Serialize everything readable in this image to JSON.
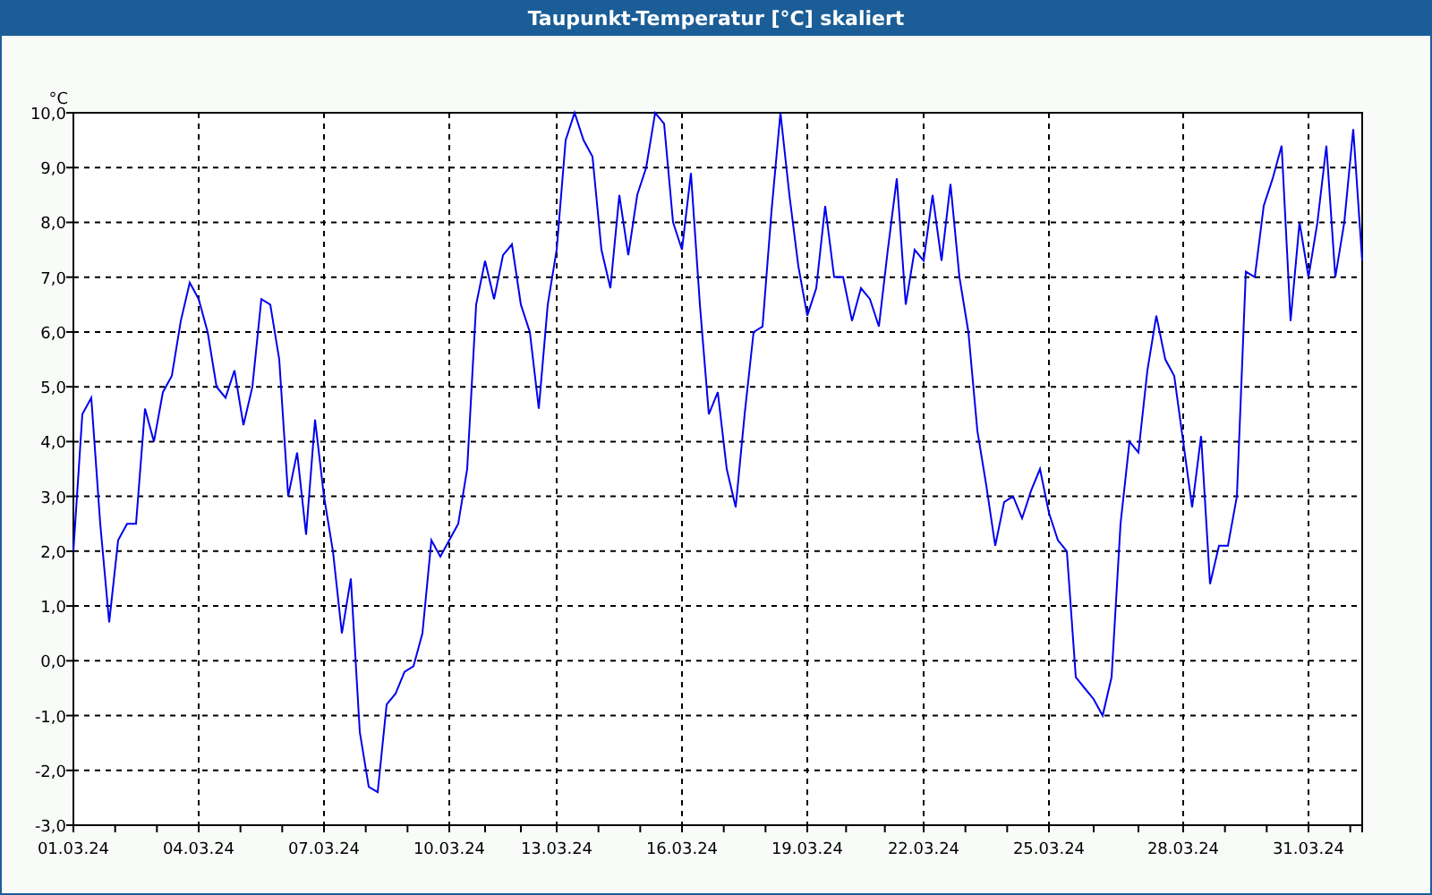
{
  "window": {
    "title": "Taupunkt-Temperatur [°C] skaliert"
  },
  "chart": {
    "chart_data": {
      "type": "line",
      "grid": true,
      "ylabel": "°C",
      "ylim": [
        -3,
        10
      ],
      "categories": [
        "01.03.24",
        null,
        null,
        null,
        null,
        null,
        null,
        null,
        null,
        null,
        null,
        null,
        null,
        null,
        "04.03.24",
        null,
        null,
        null,
        null,
        null,
        null,
        null,
        null,
        null,
        null,
        null,
        null,
        null,
        "07.03.24",
        null,
        null,
        null,
        null,
        null,
        null,
        null,
        null,
        null,
        null,
        null,
        null,
        null,
        "10.03.24",
        null,
        null,
        null,
        null,
        null,
        null,
        null,
        null,
        null,
        null,
        null,
        "13.03.24",
        null,
        null,
        null,
        null,
        null,
        null,
        null,
        null,
        null,
        null,
        null,
        null,
        null,
        "16.03.24",
        null,
        null,
        null,
        null,
        null,
        null,
        null,
        null,
        null,
        null,
        null,
        null,
        null,
        "19.03.24",
        null,
        null,
        null,
        null,
        null,
        null,
        null,
        null,
        null,
        null,
        null,
        null,
        "22.03.24",
        null,
        null,
        null,
        null,
        null,
        null,
        null,
        null,
        null,
        null,
        null,
        null,
        null,
        "25.03.24",
        null,
        null,
        null,
        null,
        null,
        null,
        null,
        null,
        null,
        null,
        null,
        null,
        null,
        null,
        "28.03.24",
        null,
        null,
        null,
        null,
        null,
        null,
        null,
        null,
        null,
        null,
        null,
        null,
        null,
        "31.03.24",
        null,
        null,
        null,
        null,
        null,
        null
      ],
      "yticks": [
        {
          "value": -3,
          "label": "-3,0"
        },
        {
          "value": -2,
          "label": "-2,0"
        },
        {
          "value": -1,
          "label": "-1,0"
        },
        {
          "value": 0,
          "label": "0,0"
        },
        {
          "value": 1,
          "label": "1,0"
        },
        {
          "value": 2,
          "label": "2,0"
        },
        {
          "value": 3,
          "label": "3,0"
        },
        {
          "value": 4,
          "label": "4,0"
        },
        {
          "value": 5,
          "label": "5,0"
        },
        {
          "value": 6,
          "label": "6,0"
        },
        {
          "value": 7,
          "label": "7,0"
        },
        {
          "value": 8,
          "label": "8,0"
        },
        {
          "value": 9,
          "label": "9,0"
        },
        {
          "value": 10,
          "label": "10,0"
        }
      ],
      "series": [
        {
          "color": "#0000ee",
          "values": [
            2.0,
            4.5,
            4.8,
            2.5,
            0.7,
            2.2,
            2.5,
            2.5,
            4.6,
            4.0,
            4.9,
            5.2,
            6.2,
            6.9,
            6.6,
            6.0,
            5.0,
            4.8,
            5.3,
            4.3,
            5.0,
            6.6,
            6.5,
            5.5,
            3.0,
            3.8,
            2.3,
            4.4,
            3.0,
            2.0,
            0.5,
            1.5,
            -1.3,
            -2.3,
            -2.4,
            -0.8,
            -0.6,
            -0.2,
            -0.1,
            0.5,
            2.2,
            1.9,
            2.2,
            2.5,
            3.5,
            6.5,
            7.3,
            6.6,
            7.4,
            7.6,
            6.5,
            6.0,
            4.6,
            6.5,
            7.5,
            9.5,
            10.0,
            9.5,
            9.2,
            7.5,
            6.8,
            8.5,
            7.4,
            8.5,
            9.0,
            10.0,
            9.8,
            8.0,
            7.5,
            8.9,
            6.5,
            4.5,
            4.9,
            3.5,
            2.8,
            4.5,
            6.0,
            6.1,
            8.2,
            10.0,
            8.5,
            7.2,
            6.3,
            6.8,
            8.3,
            7.0,
            7.0,
            6.2,
            6.8,
            6.6,
            6.1,
            7.5,
            8.8,
            6.5,
            7.5,
            7.3,
            8.5,
            7.3,
            8.7,
            7.0,
            6.0,
            4.2,
            3.2,
            2.1,
            2.9,
            3.0,
            2.6,
            3.1,
            3.5,
            2.7,
            2.2,
            2.0,
            -0.3,
            -0.5,
            -0.7,
            -1.0,
            -0.3,
            2.5,
            4.0,
            3.8,
            5.3,
            6.3,
            5.5,
            5.2,
            4.0,
            2.8,
            4.1,
            1.4,
            2.1,
            2.1,
            3.0,
            7.1,
            7.0,
            8.3,
            8.8,
            9.4,
            6.2,
            8.0,
            7.0,
            8.0,
            9.4,
            7.0,
            8.0,
            9.7,
            7.3
          ]
        }
      ]
    }
  }
}
